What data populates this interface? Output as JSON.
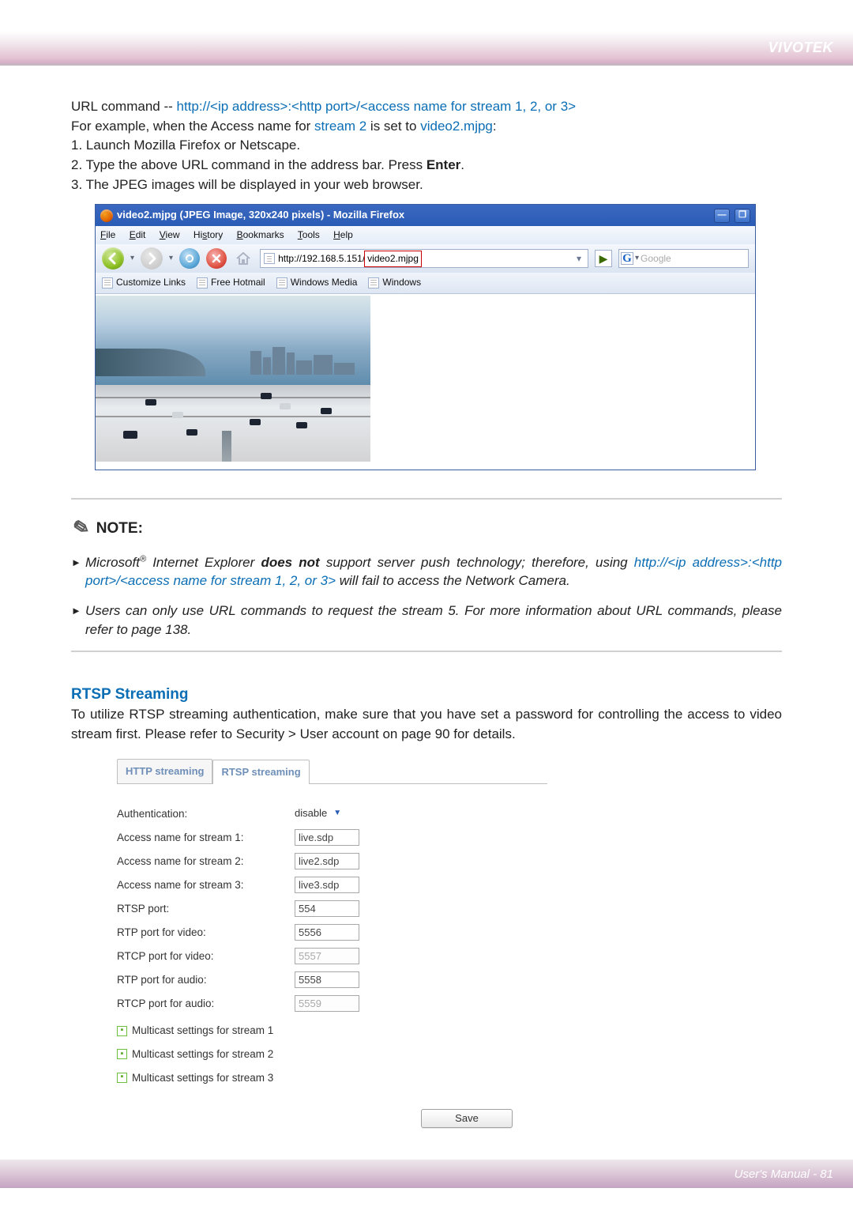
{
  "header": {
    "brand": "VIVOTEK"
  },
  "intro": {
    "prefix": "URL command -- ",
    "url_pattern": "http://<ip address>:<http port>/<access name for stream 1, 2, or 3>",
    "line2_a": "For example, when the Access name for ",
    "stream2": "stream 2",
    "line2_b": " is set to ",
    "videoname": "video2.mjpg",
    "line2_c": ":",
    "step1": "1. Launch Mozilla Firefox or Netscape.",
    "step2_a": "2. Type the above URL command in the address bar. Press ",
    "step2_b": "Enter",
    "step2_c": ".",
    "step3": "3. The JPEG images will be displayed in your web browser."
  },
  "firefox": {
    "title": "video2.mjpg (JPEG Image, 320x240 pixels) - Mozilla Firefox",
    "menus": {
      "file": "File",
      "edit": "Edit",
      "view": "View",
      "history": "History",
      "bookmarks": "Bookmarks",
      "tools": "Tools",
      "help": "Help"
    },
    "url_plain": "http://192.168.5.151/",
    "url_hl": "video2.mjpg",
    "search_placeholder": "Google",
    "bookmarks": [
      "Customize Links",
      "Free Hotmail",
      "Windows Media",
      "Windows"
    ]
  },
  "note": {
    "heading": "NOTE:",
    "n1_a": "Microsoft",
    "n1_b": " Internet Explorer ",
    "n1_c": "does not",
    "n1_d": " support server push technology; therefore, using ",
    "n1_blue": "http://<ip address>:<http port>/<access name for stream 1, 2, or 3>",
    "n1_e": " will fail to access the Network Camera.",
    "n2": "Users can only use URL commands to request the stream 5. For more information about URL commands, please refer to page 138."
  },
  "rtsp": {
    "heading": "RTSP Streaming",
    "para": "To utilize RTSP streaming authentication, make sure that you have set a password for controlling the access to video stream first. Please refer to Security > User account on page 90 for details."
  },
  "panel": {
    "tabs": {
      "http": "HTTP streaming",
      "rtsp": "RTSP streaming"
    },
    "rows": {
      "auth_label": "Authentication:",
      "auth_value": "disable",
      "an1_label": "Access name for stream 1:",
      "an1_value": "live.sdp",
      "an2_label": "Access name for stream 2:",
      "an2_value": "live2.sdp",
      "an3_label": "Access name for stream 3:",
      "an3_value": "live3.sdp",
      "rtsp_port_label": "RTSP port:",
      "rtsp_port_value": "554",
      "rtp_v_label": "RTP port for video:",
      "rtp_v_value": "5556",
      "rtcp_v_label": "RTCP port for video:",
      "rtcp_v_value": "5557",
      "rtp_a_label": "RTP port for audio:",
      "rtp_a_value": "5558",
      "rtcp_a_label": "RTCP port for audio:",
      "rtcp_a_value": "5559"
    },
    "multicast": {
      "m1": "Multicast settings for stream 1",
      "m2": "Multicast settings for stream 2",
      "m3": "Multicast settings for stream 3"
    },
    "save": "Save"
  },
  "footer": {
    "text": "User's Manual - 81"
  }
}
